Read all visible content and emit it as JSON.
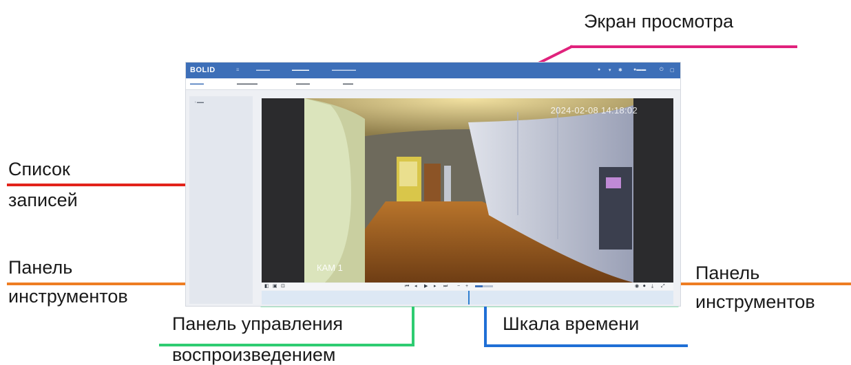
{
  "callouts": {
    "viewer_screen": "Экран просмотра",
    "records_list": [
      "Список",
      "записей"
    ],
    "toolbar_left": [
      "Панель",
      "инструментов"
    ],
    "toolbar_right": [
      "Панель",
      "инструментов"
    ],
    "playback_panel": [
      "Панель управления",
      "воспроизведением"
    ],
    "timeline": "Шкала времени"
  },
  "colors": {
    "viewer": "#e0227c",
    "records": "#e2231a",
    "toolbar": "#ee7d22",
    "playback": "#2ecc71",
    "timeline": "#1f6fd6",
    "app_header": "#3d6fb8"
  },
  "app": {
    "logo": "BOLID",
    "nav": [],
    "subtabs": [],
    "records": [],
    "video": {
      "timestamp": "2024-02-08 14:18:02",
      "camera_label": "КАМ 1"
    },
    "toolbar_left_icons": [
      "layout-icon",
      "single-view-icon",
      "zoom-icon"
    ],
    "playback_controls": [
      "skip-back-icon",
      "step-back-icon",
      "play-icon",
      "step-forward-icon",
      "skip-forward-icon",
      "slower-icon",
      "faster-icon"
    ],
    "toolbar_right_icons": [
      "snapshot-icon",
      "record-clip-icon",
      "download-icon",
      "fullscreen-icon"
    ],
    "timeline_ticks": []
  }
}
